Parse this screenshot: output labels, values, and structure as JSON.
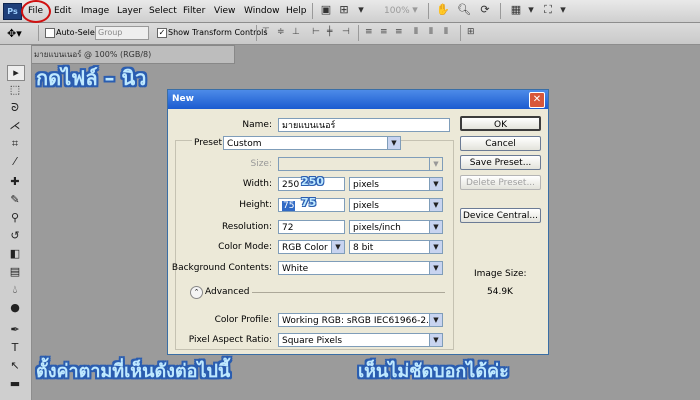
{
  "app": {
    "logo": "Ps"
  },
  "menubar": {
    "items": [
      "File",
      "Edit",
      "Image",
      "Layer",
      "Select",
      "Filter",
      "View",
      "Window",
      "Help"
    ],
    "zoom": "100%"
  },
  "options_bar": {
    "auto_select_label": "Auto-Select:",
    "auto_select_value": "Group",
    "show_transform_label": "Show Transform Controls"
  },
  "document_tab": "มายแบนเนอร์ @ 100% (RGB/8)",
  "overlay": {
    "top": "กดไฟล์ – นิว",
    "bottom_left": "ตั้งค่าตามที่เห็นดังต่อไปนี้",
    "bottom_right": "เห็นไม่ชัดบอกได้ค่ะ"
  },
  "dialog": {
    "title": "New",
    "name_label": "Name:",
    "name_value": "มายแบนเนอร์",
    "preset_label": "Preset:",
    "preset_value": "Custom",
    "size_label": "Size:",
    "size_value": "",
    "width_label": "Width:",
    "width_value": "250",
    "width_hand": "250",
    "width_unit": "pixels",
    "height_label": "Height:",
    "height_value": "75",
    "height_hand": "75",
    "height_unit": "pixels",
    "resolution_label": "Resolution:",
    "resolution_value": "72",
    "resolution_unit": "pixels/inch",
    "color_mode_label": "Color Mode:",
    "color_mode_value": "RGB Color",
    "bit_depth_value": "8 bit",
    "background_label": "Background Contents:",
    "background_value": "White",
    "advanced_label": "Advanced",
    "color_profile_label": "Color Profile:",
    "color_profile_value": "Working RGB:  sRGB IEC61966-2.1",
    "aspect_label": "Pixel Aspect Ratio:",
    "aspect_value": "Square Pixels",
    "buttons": {
      "ok": "OK",
      "cancel": "Cancel",
      "save_preset": "Save Preset...",
      "delete_preset": "Delete Preset...",
      "device_central": "Device Central..."
    },
    "image_size_label": "Image Size:",
    "image_size_value": "54.9K"
  },
  "colors": {
    "annotation_fill": "#bfe9ff",
    "annotation_outline": "#2a5db0",
    "title_blue": "#1b5bd0",
    "file_circle": "#d01010"
  }
}
